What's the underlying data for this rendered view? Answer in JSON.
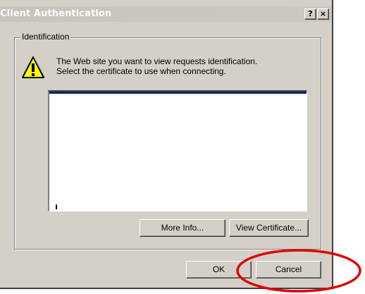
{
  "window": {
    "title": "Client Authentication",
    "help_button": "?",
    "close_button": "×"
  },
  "identification": {
    "legend": "Identification",
    "message_line1": "The Web site you want to view requests identification.",
    "message_line2": "Select the certificate to use when connecting."
  },
  "certificate_list": {
    "items": []
  },
  "buttons": {
    "more_info": "More Info...",
    "view_certificate": "View Certificate...",
    "ok": "OK",
    "cancel": "Cancel"
  },
  "icons": {
    "warning": "warning-icon",
    "annotation": "red-ellipse-annotation"
  },
  "colors": {
    "dialog_face": "#d4d0c8",
    "title_text": "#ffffff",
    "list_focus": "#0a246a",
    "warning_fill": "#ffff00",
    "annotation": "#e00000"
  }
}
